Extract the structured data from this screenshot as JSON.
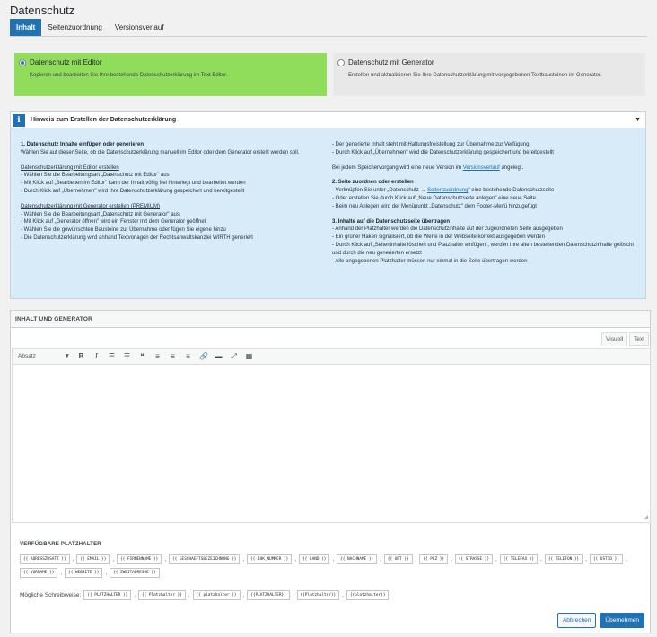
{
  "page": {
    "title": "Datenschutz"
  },
  "tabs": [
    "Inhalt",
    "Seitenzuordnung",
    "Versionsverlauf"
  ],
  "modes": [
    {
      "label": "Datenschutz mit Editor",
      "desc": "Kopieren und bearbeiten Sie Ihre bestehende Datenschutzerklärung im Text Editor.",
      "selected": true
    },
    {
      "label": "Datenschutz mit Generator",
      "desc": "Erstellen und aktualisieren Sie Ihre Datenschutzerklärung mit vorgegebenen Textbausteinen im Generator.",
      "selected": false
    }
  ],
  "hint": {
    "icon": "i",
    "title": "Hinweis zum Erstellen der Datenschutzerklärung",
    "toggle": "▼",
    "left": {
      "h1": "1. Datenschutz Inhalte einfügen oder generieren",
      "p1": "Wählen Sie auf dieser Seite, ob die Datenschutzerklärung manuell im Editor oder dem Generator erstellt werden soll.",
      "u1": "Datenschutzerklärung mit Editor erstellen",
      "l1": [
        "- Wählen Sie die Bearbeitungsart „Datenschutz mit Editor\" aus",
        "- Mit Klick auf „Bearbeiten im Editor\" kann der Inhalt völlig frei hinterlegt und bearbeitet werden",
        "- Durch Klick auf „Übernehmen\" wird Ihre Datenschutzerklärung gespeichert und bereitgestellt"
      ],
      "u2": "Datenschutzerklärung mit Generator erstellen (PREMIUM)",
      "l2": [
        "- Wählen Sie die Bearbeitungsart „Datenschutz mit Generator\" aus",
        "- Mit Klick auf „Generator öffnen\" wird ein Fenster mit dem Generator geöffnet",
        "- Wählen Sie die gewünschten Bausteine zur Übernahme oder fügen Sie eigene hinzu",
        "- Die Datenschutzerklärung wird anhand Textvorlagen der Rechtsanwaltskanzlei WIRTH generiert"
      ]
    },
    "right": {
      "l0": [
        "- Der generierte Inhalt steht mit Haftungsfreistellung zur Übernahme zur Verfügung",
        "- Durch Klick auf „Übernehmen\" wird die Datenschutzerklärung gespeichert und bereitgestellt"
      ],
      "save_pre": "Bei jedem Speichervorgang wird eine neue Version im ",
      "save_link": "Versionsverlauf",
      "save_post": " angelegt.",
      "h2": "2. Seite zuordnen oder erstellen",
      "l2a_pre": "- Verknüpfen Sie unter „Datenschutz → ",
      "l2a_link": "Seitenzuordnung",
      "l2a_post": "\" eine bestehende Datenschutzseite",
      "l2": [
        "- Oder erstellen Sie durch Klick auf „Neue Datenschutzseite anlegen\" eine neue Seite",
        "- Beim neu Anlegen wird der Menüpunkt „Datenschutz\" dem Footer-Menü hinzugefügt"
      ],
      "h3": "3. Inhalte auf die Datenschutzseite übertragen",
      "l3": [
        "- Anhand der Platzhalter werden die Datenschutzinhalte auf der zugeordneten Seite ausgegeben",
        "- Ein grüner Haken signalisiert, ob die Werte in der Webseite korrekt ausgegeben werden",
        "- Durch Klick auf „Seiteninhalte löschen und Platzhalter einfügen\", werden Ihre alten bestehenden Datenschutzinhalte gelöscht und durch die neu generierten ersetzt",
        "- Alle angegebenen Platzhalter müssen nur einmal in die Seite übertragen werden"
      ]
    }
  },
  "editor": {
    "title": "INHALT UND GENERATOR",
    "mode_tabs": [
      "Visuell",
      "Text"
    ],
    "format": "Absatz",
    "format_arrow": "▼",
    "toolbar_icons": [
      "bold-icon",
      "italic-icon",
      "bullet-list-icon",
      "numbered-list-icon",
      "blockquote-icon",
      "align-left-icon",
      "align-center-icon",
      "align-right-icon",
      "link-icon",
      "read-more-icon",
      "fullscreen-icon",
      "toolbar-toggle-icon"
    ],
    "toolbar_glyphs": [
      "B",
      "I",
      "☰",
      "☷",
      "❝",
      "≡",
      "≡",
      "≡",
      "🔗",
      "▬",
      "⤢",
      "▦"
    ],
    "resize_glyph": "◢"
  },
  "placeholders": {
    "title": "VERFÜGBARE PLATZHALTER",
    "separator": ",",
    "items": [
      "{{ ADRESSZUSATZ }}",
      "{{ EMAIL }}",
      "{{ FIRMENNAME }}",
      "{{ GESCHAEFTSBEZEICHNUNG }}",
      "{{ IHK_NUMMER }}",
      "{{ LAND }}",
      "{{ NACHNAME }}",
      "{{ ORT }}",
      "{{ PLZ }}",
      "{{ STRASSE }}",
      "{{ TELEFAX }}",
      "{{ TELEFON }}",
      "{{ USTID }}",
      "{{ VORNAME }}",
      "{{ WEBSITE }}",
      "{{ ZWEITADRESSE }}"
    ],
    "writes_label": "Mögliche Schreibweise:",
    "writes": [
      "{{ PLATZHALTER }}",
      "{{ Platzhalter }}",
      "{{ platzhalter }}",
      "{{PLATZHALTER}}",
      "{{Platzhalter}}",
      "{{platzhalter}}"
    ]
  },
  "buttons": {
    "cancel": "Abbrechen",
    "apply": "Übernehmen"
  }
}
